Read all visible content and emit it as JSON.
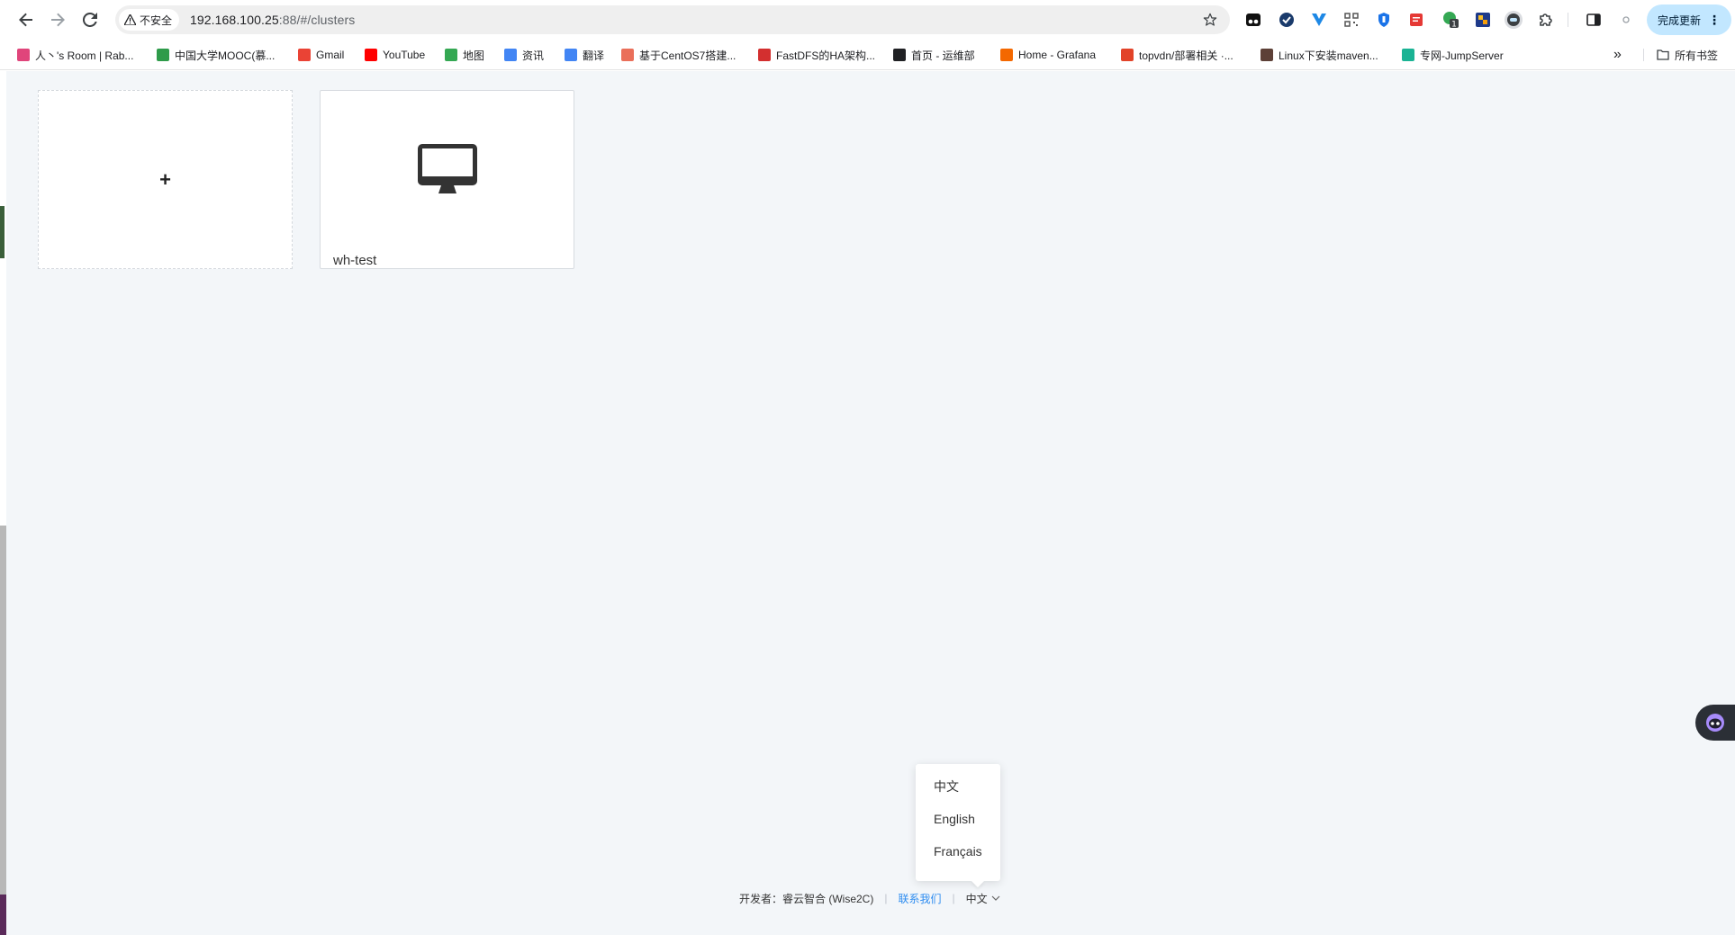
{
  "browser": {
    "security_label": "不安全",
    "url_host": "192.168.100.25",
    "url_rest": ":88/#/clusters",
    "update_label": "完成更新",
    "extension_badge": "1"
  },
  "bookmarks": [
    {
      "label": "人丶's Room | Rab...",
      "icon": "pinwheel-icon",
      "color": "#e0457b"
    },
    {
      "label": "中国大学MOOC(慕...",
      "icon": "mooc-icon",
      "color": "#2e9b4a"
    },
    {
      "label": "Gmail",
      "icon": "gmail-icon",
      "color": "#ea4335"
    },
    {
      "label": "YouTube",
      "icon": "youtube-icon",
      "color": "#ff0000"
    },
    {
      "label": "地图",
      "icon": "maps-icon",
      "color": "#34a853"
    },
    {
      "label": "资讯",
      "icon": "news-icon",
      "color": "#4285f4"
    },
    {
      "label": "翻译",
      "icon": "translate-icon",
      "color": "#4285f4"
    },
    {
      "label": "基于CentOS7搭建...",
      "icon": "jianshu-icon",
      "color": "#ea6f5a"
    },
    {
      "label": "FastDFS的HA架构...",
      "icon": "51cto-icon",
      "color": "#d32f2f"
    },
    {
      "label": "首页 - 运维部",
      "icon": "globe-icon",
      "color": "#202124"
    },
    {
      "label": "Home - Grafana",
      "icon": "grafana-icon",
      "color": "#f46800"
    },
    {
      "label": "topvdn/部署相关 ·...",
      "icon": "gitlab-icon",
      "color": "#e24329"
    },
    {
      "label": "Linux下安装maven...",
      "icon": "avatar-icon",
      "color": "#5d4037"
    },
    {
      "label": "专网-JumpServer",
      "icon": "jumpserver-icon",
      "color": "#1ab394"
    }
  ],
  "all_bookmarks_label": "所有书签",
  "clusters": {
    "add_symbol": "+",
    "items": [
      {
        "name": "wh-test"
      }
    ]
  },
  "language_menu": {
    "options": [
      "中文",
      "English",
      "Français"
    ]
  },
  "footer": {
    "developer_label": "开发者：睿云智合 (Wise2C)",
    "contact_label": "联系我们",
    "current_language": "中文"
  },
  "colors": {
    "page_bg": "#f3f6f9",
    "link": "#2d8cf0",
    "update_btn_bg": "#c2e7ff"
  }
}
